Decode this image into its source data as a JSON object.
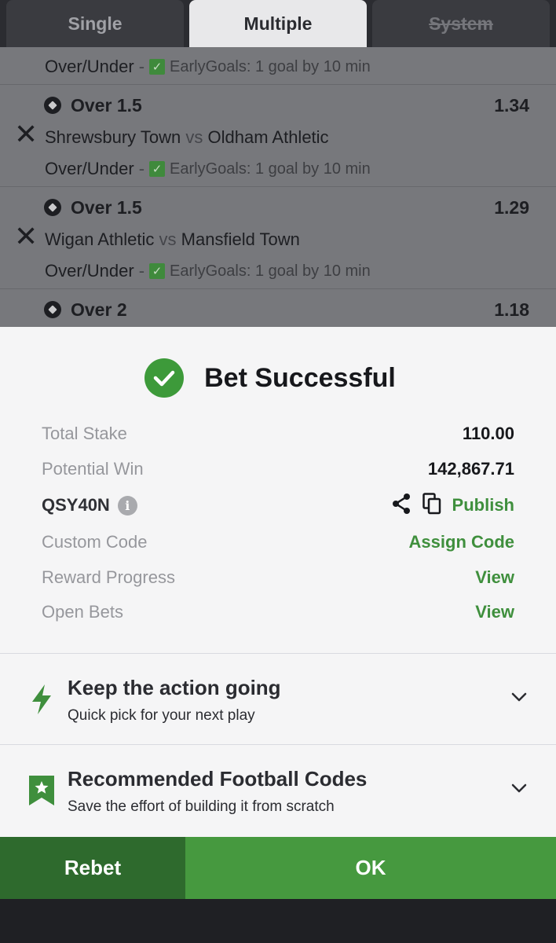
{
  "tabs": [
    {
      "label": "Single",
      "active": false
    },
    {
      "label": "Multiple",
      "active": true
    },
    {
      "label": "System",
      "active": false,
      "disabled": true
    }
  ],
  "selections": [
    {
      "market": "Over/Under",
      "dash": "-",
      "boost": "EarlyGoals: 1 goal by 10 min"
    },
    {
      "title": "Over 1.5",
      "odds": "1.34",
      "home": "Shrewsbury Town",
      "vs": "vs",
      "away": "Oldham Athletic",
      "market": "Over/Under",
      "dash": "-",
      "boost": "EarlyGoals: 1 goal by 10 min"
    },
    {
      "title": "Over 1.5",
      "odds": "1.29",
      "home": "Wigan Athletic",
      "vs": "vs",
      "away": "Mansfield Town",
      "market": "Over/Under",
      "dash": "-",
      "boost": "EarlyGoals: 1 goal by 10 min"
    },
    {
      "title": "Over 2",
      "odds": "1.18"
    }
  ],
  "success": {
    "title": "Bet Successful",
    "total_stake_label": "Total Stake",
    "total_stake": "110.00",
    "potential_win_label": "Potential Win",
    "potential_win": "142,867.71",
    "booking_code": "QSY40N",
    "publish_label": "Publish",
    "custom_code_label": "Custom Code",
    "assign_code_label": "Assign Code",
    "reward_progress_label": "Reward Progress",
    "reward_view_label": "View",
    "open_bets_label": "Open Bets",
    "open_bets_view_label": "View"
  },
  "promos": [
    {
      "title": "Keep the action going",
      "subtitle": "Quick pick for your next play"
    },
    {
      "title": "Recommended Football Codes",
      "subtitle": "Save the effort of building it from scratch"
    }
  ],
  "buttons": {
    "rebet": "Rebet",
    "ok": "OK"
  },
  "colors": {
    "accent_green": "#3f8f3d",
    "ok_green": "#46993f",
    "rebet_green": "#2e6a2d"
  }
}
